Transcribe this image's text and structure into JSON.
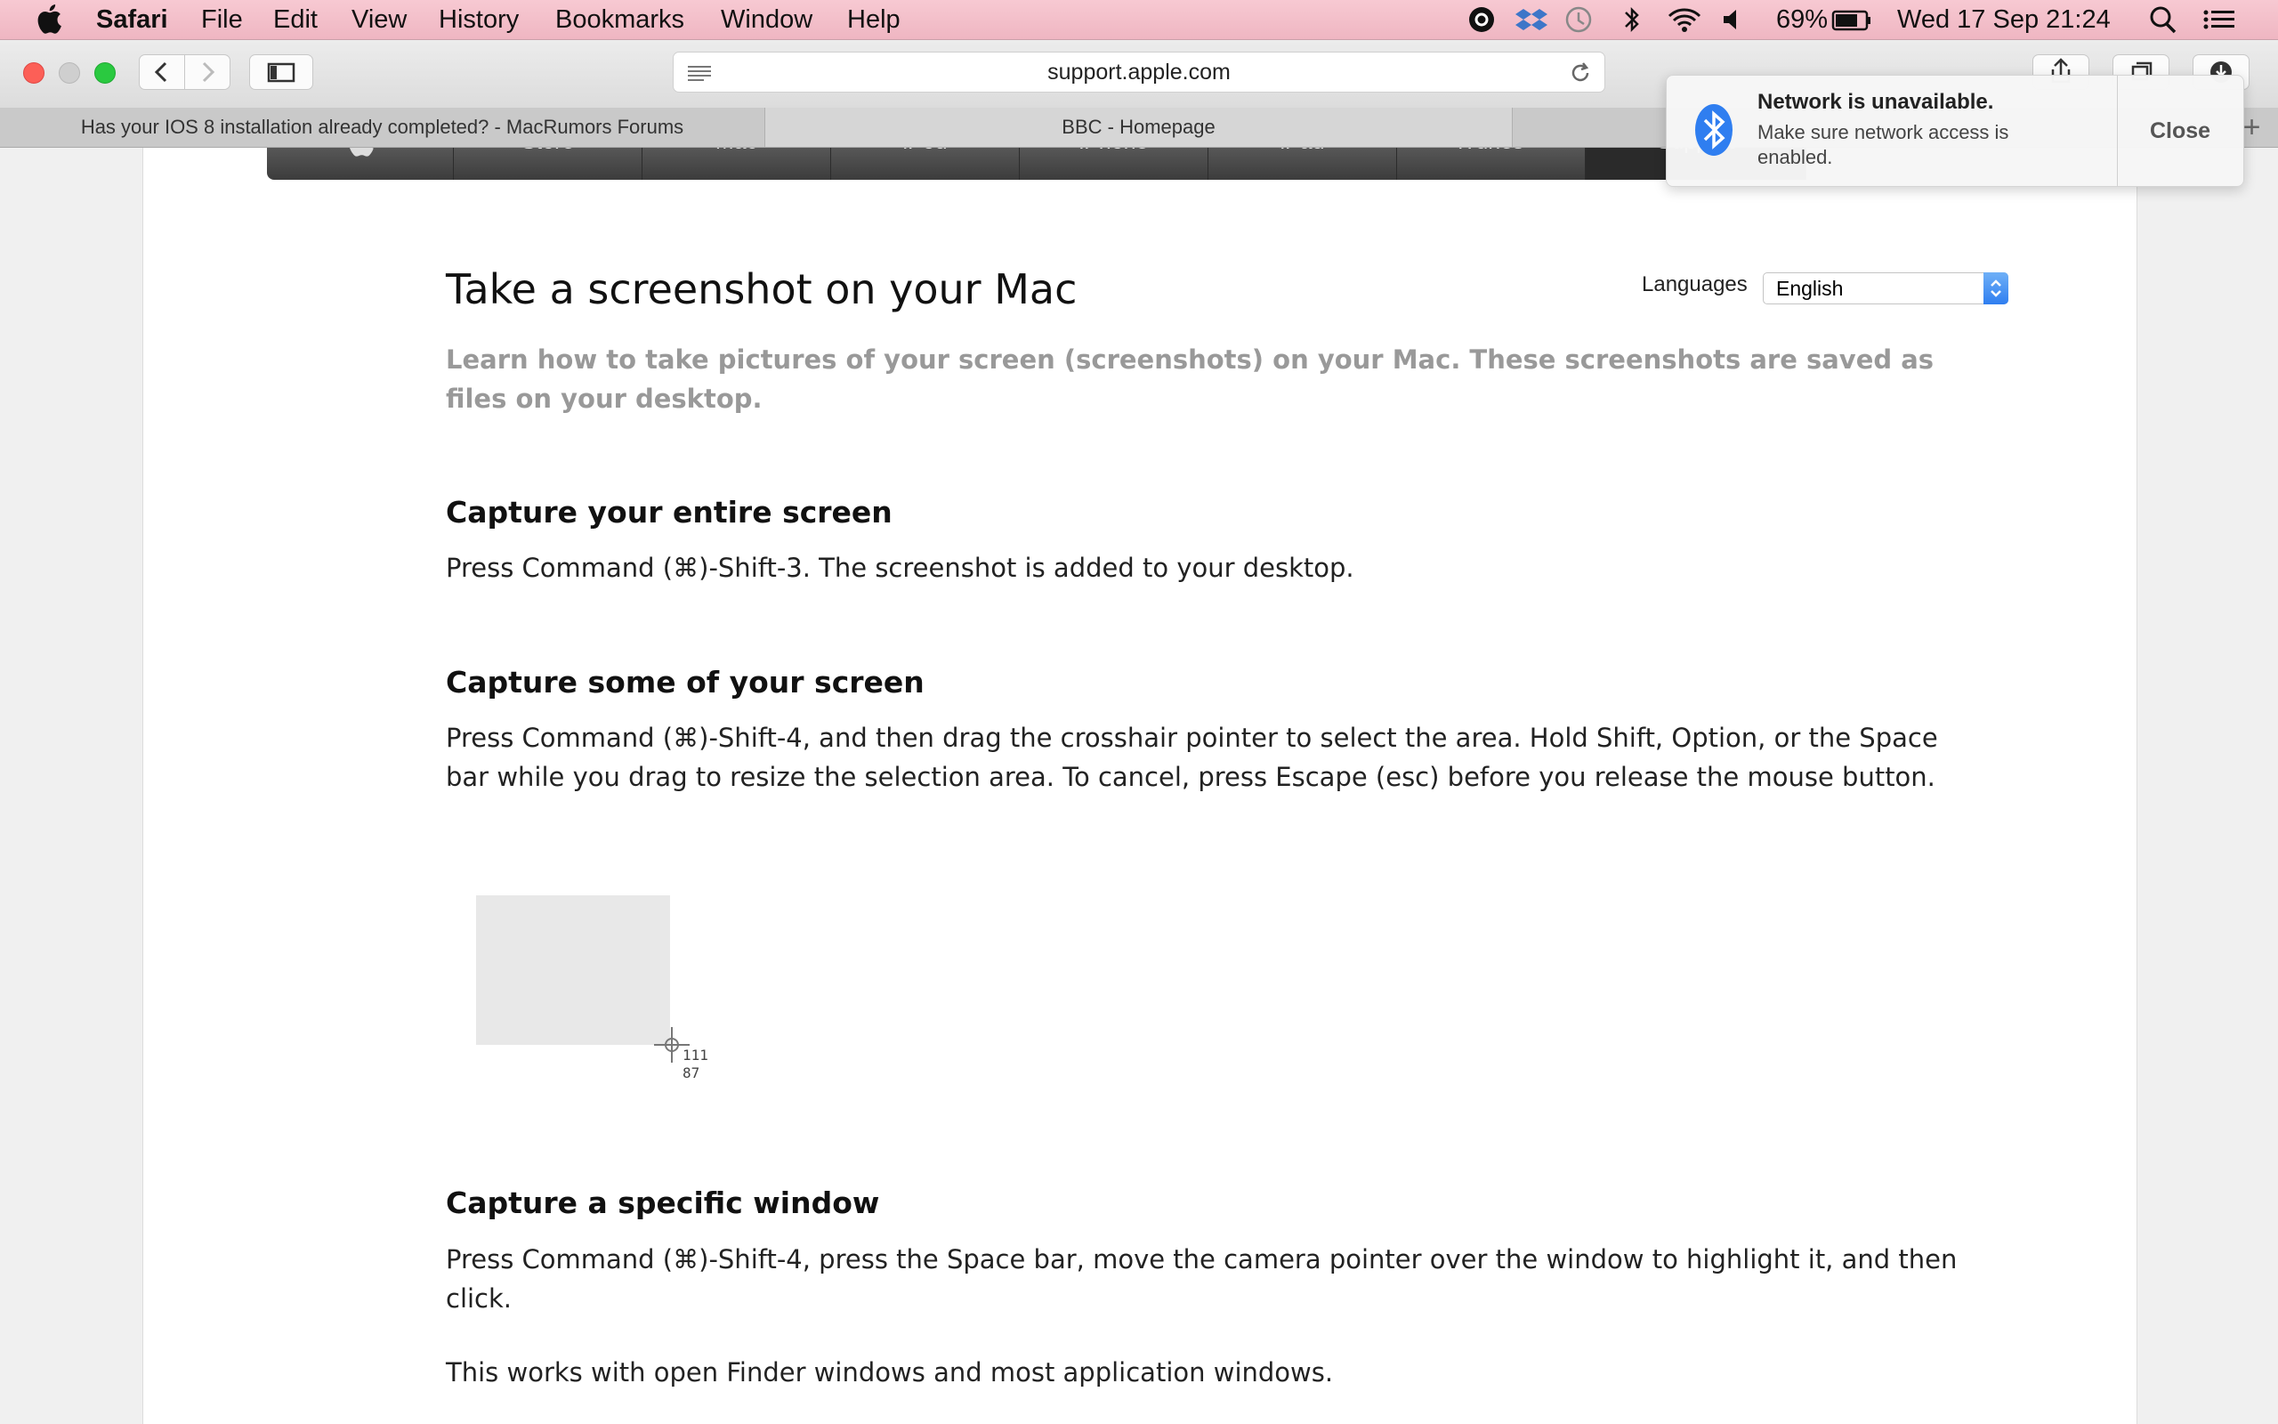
{
  "menubar": {
    "app": "Safari",
    "items": [
      "File",
      "Edit",
      "View",
      "History",
      "Bookmarks",
      "Window",
      "Help"
    ],
    "battery": "69%",
    "datetime": "Wed 17 Sep  21:24"
  },
  "toolbar": {
    "url": "support.apple.com"
  },
  "tabs": [
    {
      "label": "Has your IOS 8 installation already completed? - MacRumors Forums"
    },
    {
      "label": "BBC - Homepage"
    }
  ],
  "globalnav": {
    "items": [
      "Store",
      "Mac",
      "iPod",
      "iPhone",
      "iPad",
      "iTunes",
      "Support"
    ]
  },
  "article": {
    "title": "Take a screenshot on your Mac",
    "languages_label": "Languages",
    "language_value": "English",
    "subtitle": "Learn how to take pictures of your screen (screenshots) on your Mac. These screenshots are saved as files on your desktop.",
    "sections": [
      {
        "heading": "Capture your entire screen",
        "body": "Press Command (⌘)-Shift-3. The screenshot is added to your desktop."
      },
      {
        "heading": "Capture some of your screen",
        "body": "Press Command (⌘)-Shift-4, and then drag the crosshair pointer to select the area. Hold Shift, Option, or the Space bar while you drag to resize the selection area. To cancel, press Escape (esc) before you release the mouse button."
      },
      {
        "heading": "Capture a specific window",
        "body": "Press Command (⌘)-Shift-4, press the Space bar, move the camera pointer over the window to highlight it, and then click.",
        "body2": "This works with open Finder windows and most application windows."
      }
    ],
    "demo": {
      "width_label": "111",
      "height_label": "87"
    }
  },
  "notification": {
    "title": "Network is unavailable.",
    "body": "Make sure network access is enabled.",
    "close": "Close"
  },
  "colors": {
    "menubar": "#efb6c2",
    "close": "#fc5f57",
    "minimize": "#c8c8c8",
    "zoom": "#2ac940",
    "select_accent": "#2f7ef0",
    "bluetooth": "#2f7ef0"
  }
}
